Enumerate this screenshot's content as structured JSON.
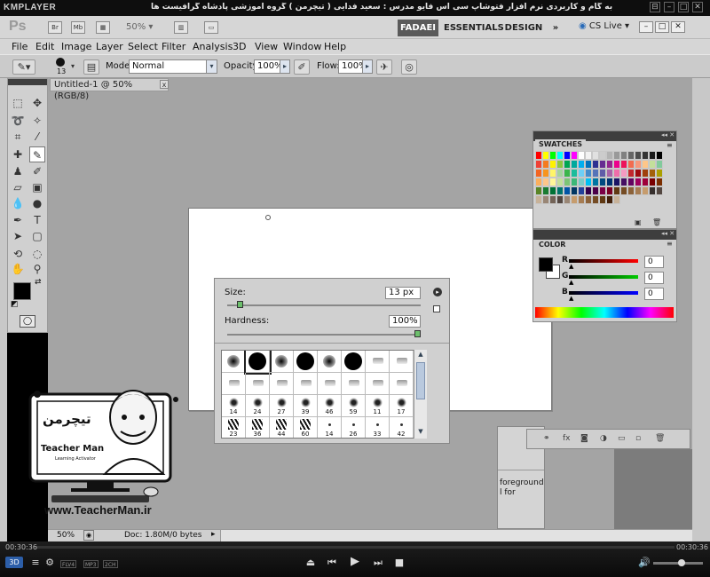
{
  "km": {
    "logo": "KMPLAYER",
    "title": "مجموعه آموزشی جامع ، گام به گام و کاربردی نرم افزار فتوشاپ سی اس فایو  مدرس : سعید فدایی ( تیچرمن ) گروه آموزشی پادشاه گرافیست ها",
    "win_buttons": [
      "⊟",
      "–",
      "□",
      "✕"
    ]
  },
  "ps": {
    "logo": "Ps",
    "app_buttons": [
      "Br",
      "Mb"
    ],
    "zoom": "50%",
    "workspaces": [
      "FADAEI",
      "ESSENTIALS",
      "DESIGN"
    ],
    "more": "»",
    "cslive": "CS Live",
    "win_buttons": [
      "–",
      "□",
      "✕"
    ]
  },
  "menu": [
    "File",
    "Edit",
    "Image",
    "Layer",
    "Select",
    "Filter",
    "Analysis",
    "3D",
    "View",
    "Window",
    "Help"
  ],
  "options": {
    "brush_size": "13",
    "mode_label": "Mode:",
    "mode_value": "Normal",
    "opacity_label": "Opacity:",
    "opacity_value": "100%",
    "flow_label": "Flow:",
    "flow_value": "100%"
  },
  "doc": {
    "tab_title": "Untitled-1 @ 50% (RGB/8)",
    "close": "x"
  },
  "brush_popup": {
    "size_label": "Size:",
    "size_value": "13 px",
    "size_level": 0.05,
    "hardness_label": "Hardness:",
    "hardness_value": "100%",
    "hardness_level": 1.0,
    "presets": [
      {
        "label": "",
        "shape": "soft"
      },
      {
        "label": "",
        "shape": "hard"
      },
      {
        "label": "",
        "shape": "soft"
      },
      {
        "label": "",
        "shape": "hard"
      },
      {
        "label": "",
        "shape": "soft"
      },
      {
        "label": "",
        "shape": "hard"
      },
      {
        "label": "",
        "shape": "tip"
      },
      {
        "label": "",
        "shape": "tip"
      },
      {
        "label": "",
        "shape": "tip"
      },
      {
        "label": "",
        "shape": "tip"
      },
      {
        "label": "",
        "shape": "tip"
      },
      {
        "label": "",
        "shape": "tip"
      },
      {
        "label": "",
        "shape": "tip"
      },
      {
        "label": "",
        "shape": "tip"
      },
      {
        "label": "",
        "shape": "tip"
      },
      {
        "label": "",
        "shape": "tip"
      },
      {
        "label": "14",
        "shape": "spatter"
      },
      {
        "label": "24",
        "shape": "spatter"
      },
      {
        "label": "27",
        "shape": "spatter"
      },
      {
        "label": "39",
        "shape": "spatter"
      },
      {
        "label": "46",
        "shape": "spatter"
      },
      {
        "label": "59",
        "shape": "spatter"
      },
      {
        "label": "11",
        "shape": "spatter"
      },
      {
        "label": "17",
        "shape": "spatter"
      },
      {
        "label": "23",
        "shape": "grass"
      },
      {
        "label": "36",
        "shape": "grass"
      },
      {
        "label": "44",
        "shape": "grass"
      },
      {
        "label": "60",
        "shape": "grass"
      },
      {
        "label": "14",
        "shape": "dot"
      },
      {
        "label": "26",
        "shape": "dot"
      },
      {
        "label": "33",
        "shape": "dot"
      },
      {
        "label": "42",
        "shape": "dot"
      }
    ]
  },
  "swatches": {
    "title": "SWATCHES",
    "colors": [
      [
        "#ff0000",
        "#ffff00",
        "#00ff00",
        "#00ffff",
        "#0000ff",
        "#ff00ff",
        "#ffffff",
        "#f2f2f2",
        "#e0e0e0",
        "#cccccc",
        "#b3b3b3",
        "#999999",
        "#808080",
        "#666666",
        "#4d4d4d",
        "#333333",
        "#1a1a1a",
        "#000000"
      ],
      [
        "#ef4136",
        "#f47b20",
        "#fff200",
        "#8dc63f",
        "#00a651",
        "#00a99d",
        "#00aeef",
        "#0072bc",
        "#2e3192",
        "#662d91",
        "#92278f",
        "#ec008c",
        "#ed145b",
        "#f26c4f",
        "#f7977a",
        "#fdc689",
        "#c4df9b",
        "#82ca9c"
      ],
      [
        "#f26522",
        "#f7941d",
        "#fff568",
        "#a3d39c",
        "#39b54a",
        "#1abc9c",
        "#6dcff6",
        "#448ccb",
        "#5674b9",
        "#605ca8",
        "#a864a8",
        "#f06eaa",
        "#f49ac1",
        "#c1272d",
        "#9e0b0f",
        "#a0410d",
        "#a3620a",
        "#aba000"
      ],
      [
        "#fbaf5d",
        "#fdc689",
        "#fff799",
        "#c4df9b",
        "#7cc576",
        "#3cb878",
        "#7accc8",
        "#00bff3",
        "#0076a3",
        "#004a80",
        "#003471",
        "#1b1464",
        "#440e62",
        "#630460",
        "#9e005d",
        "#9e0039",
        "#790000",
        "#7b2e00"
      ],
      [
        "#598527",
        "#197b30",
        "#007236",
        "#00746b",
        "#0054a6",
        "#003663",
        "#21409a",
        "#32004b",
        "#4b0049",
        "#7b0046",
        "#7a0026",
        "#603913",
        "#754c24",
        "#8c6239",
        "#a67c52",
        "#c69c6d",
        "#362f2d",
        "#534741"
      ],
      [
        "#c7b299",
        "#998675",
        "#736357",
        "#534741",
        "#998675",
        "#c69c6d",
        "#a67c52",
        "#8c6239",
        "#754c24",
        "#603913",
        "#42210b",
        "#c7b299"
      ]
    ]
  },
  "color_panel": {
    "title": "COLOR",
    "channels": [
      {
        "label": "R",
        "value": "0"
      },
      {
        "label": "G",
        "value": "0"
      },
      {
        "label": "B",
        "value": "0"
      }
    ]
  },
  "layers": {
    "text1": "foreground",
    "text2": "l for"
  },
  "watermark": {
    "url": "www.TeacherMan.ir",
    "brand": "Teacher Man",
    "fa": "تیچرمن",
    "sub": "Learning Activator"
  },
  "status": {
    "zoom": "50%",
    "doc": "Doc: 1.80M/0 bytes"
  },
  "player": {
    "time_left": "00:30:36",
    "time_right": "00:30:36",
    "badges": [
      "FLV4",
      "MP3",
      "2CH"
    ],
    "three_d": "3D"
  }
}
